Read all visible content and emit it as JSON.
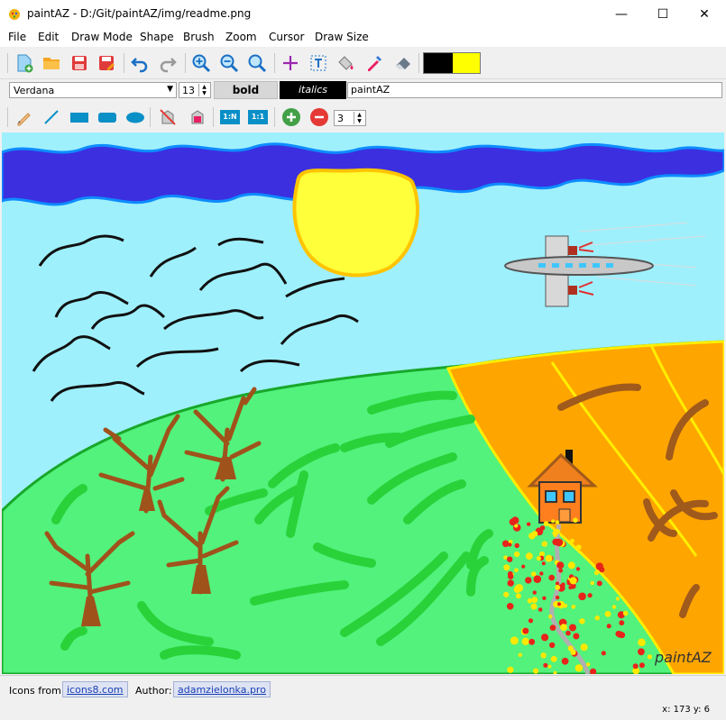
{
  "window": {
    "title": "paintAZ - D:/Git/paintAZ/img/readme.png",
    "controls": [
      "—",
      "☐",
      "✕"
    ]
  },
  "menu": [
    "File",
    "Edit",
    "Draw Mode",
    "Shape",
    "Brush",
    "Zoom",
    "Cursor",
    "Draw Size"
  ],
  "toolbar": {
    "icons": [
      "new-file-icon",
      "open-folder-icon",
      "save-icon",
      "save-as-icon",
      "undo-icon",
      "redo-icon",
      "zoom-in-icon",
      "zoom-out-icon",
      "zoom-fit-icon",
      "crosshair-icon",
      "text-tool-icon",
      "fill-bucket-icon",
      "color-picker-icon",
      "eraser-icon"
    ],
    "primary_color": "#000000",
    "secondary_color": "#ffff00"
  },
  "text_toolbar": {
    "font": "Verdana",
    "size": "13",
    "bold_label": "bold",
    "italics_label": "italics",
    "text_value": "paintAZ"
  },
  "shape_toolbar": {
    "ratio_n_label": "1:N",
    "ratio_1_label": "1:1",
    "draw_size": "3"
  },
  "canvas": {
    "watermark": "paintAZ"
  },
  "status": {
    "icons_label": "Icons from:",
    "icons_link": "icons8.com",
    "author_label": "Author:",
    "author_link": "adamzielonka.pro",
    "cursor_pos": "x: 173 y: 6"
  }
}
